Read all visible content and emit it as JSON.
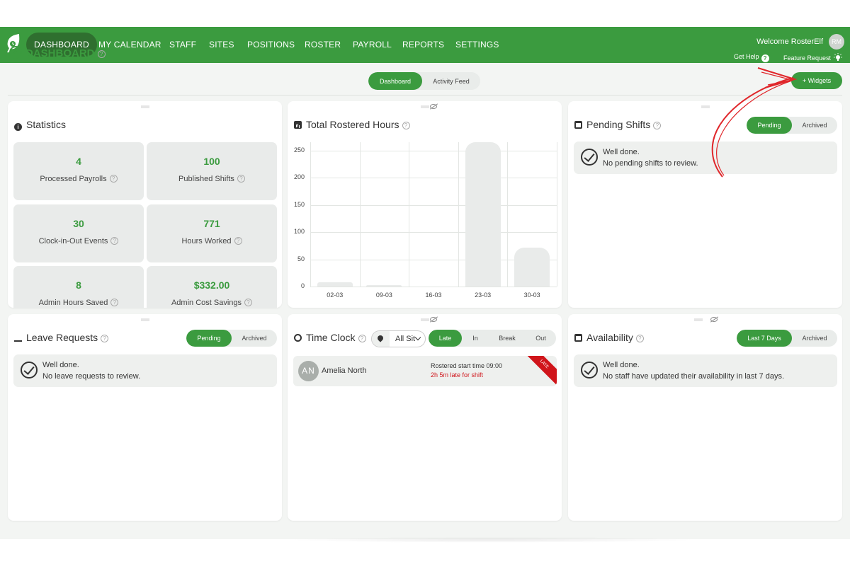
{
  "nav": {
    "items": [
      "DASHBOARD",
      "MY CALENDAR",
      "STAFF",
      "SITES",
      "POSITIONS",
      "ROSTER",
      "PAYROLL",
      "REPORTS",
      "SETTINGS"
    ],
    "active": "DASHBOARD",
    "welcome": "Welcome RosterElf",
    "avatar_initials": "RM",
    "get_help": "Get Help",
    "feature_request": "Feature Request"
  },
  "header": {
    "title": "DASHBOARD",
    "view_tabs": [
      "Dashboard",
      "Activity Feed"
    ],
    "active_view": "Dashboard",
    "widgets_button": "+ Widgets"
  },
  "statistics": {
    "title": "Statistics",
    "items": [
      {
        "value": "4",
        "label": "Processed Payrolls"
      },
      {
        "value": "100",
        "label": "Published Shifts"
      },
      {
        "value": "30",
        "label": "Clock-in-Out Events"
      },
      {
        "value": "771",
        "label": "Hours Worked"
      },
      {
        "value": "8",
        "label": "Admin Hours Saved"
      },
      {
        "value": "$332.00",
        "label": "Admin Cost Savings"
      }
    ]
  },
  "rostered_hours": {
    "title": "Total Rostered Hours"
  },
  "chart_data": {
    "type": "bar",
    "title": "Total Rostered Hours",
    "categories": [
      "02-03",
      "09-03",
      "16-03",
      "23-03",
      "30-03"
    ],
    "values": [
      8,
      3,
      0,
      265,
      72
    ],
    "yticks": [
      "0",
      "50",
      "100",
      "150",
      "200",
      "250"
    ],
    "ylim": [
      0,
      265
    ],
    "grid": true
  },
  "pending_shifts": {
    "title": "Pending Shifts",
    "tabs": [
      "Pending",
      "Archived"
    ],
    "active": "Pending",
    "msg1": "Well done.",
    "msg2": "No pending shifts to review."
  },
  "leave_requests": {
    "title": "Leave Requests",
    "tabs": [
      "Pending",
      "Archived"
    ],
    "active": "Pending",
    "msg1": "Well done.",
    "msg2": "No leave requests to review."
  },
  "time_clock": {
    "title": "Time Clock",
    "site_select": "All Sites",
    "tabs": [
      "Late",
      "In",
      "Break",
      "Out"
    ],
    "active": "Late",
    "row": {
      "initials": "AN",
      "name": "Amelia North",
      "start": "Rostered start time 09:00",
      "late": "2h 5m late for shift",
      "badge": "LATE"
    }
  },
  "availability": {
    "title": "Availability",
    "tabs": [
      "Last 7 Days",
      "Archived"
    ],
    "active": "Last 7 Days",
    "msg1": "Well done.",
    "msg2": "No staff have updated their availability in last 7 days."
  },
  "colors": {
    "brand": "#3b9b3f",
    "late": "#d0151b",
    "annotation_arrow": "#e0262a"
  }
}
